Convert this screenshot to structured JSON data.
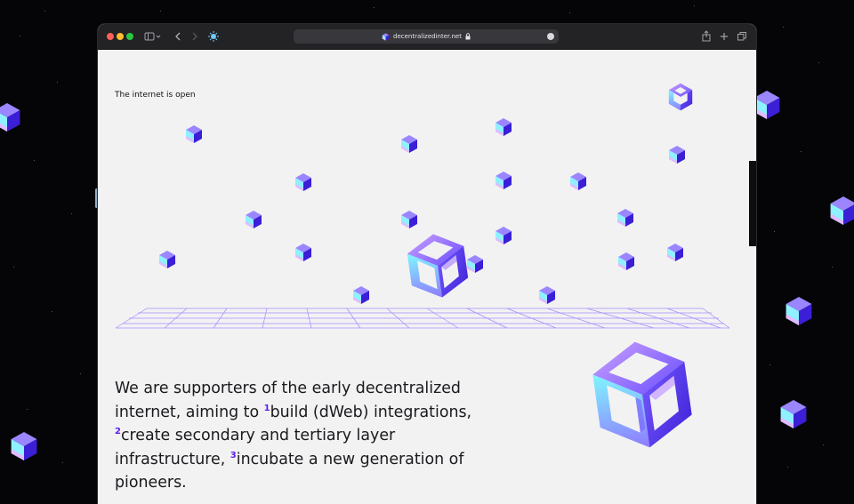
{
  "browser": {
    "url": "decentralizedinter.net",
    "icons": [
      "sidebar-icon",
      "back-icon",
      "forward-icon",
      "site-favicon-icon",
      "lock-icon",
      "more-icon",
      "share-icon",
      "new-tab-icon",
      "tabs-overview-icon"
    ]
  },
  "page": {
    "tagline": "The internet is open",
    "intro_1": "We are supporters of the early decentralized internet, aiming to ",
    "fn_1": "1",
    "intro_2": "build (dWeb) integrations, ",
    "fn_2": "2",
    "intro_3": "create secondary and tertiary layer infrastructure, ",
    "fn_3": "3",
    "intro_4": "incubate a new generation of pioneers."
  },
  "colors": {
    "accent": "#5b1ff0",
    "cube_top": "#8e7bff",
    "cube_left": "#7ff2ff",
    "cube_right": "#3b1fd8",
    "cube_pink": "#e6a8ff"
  }
}
